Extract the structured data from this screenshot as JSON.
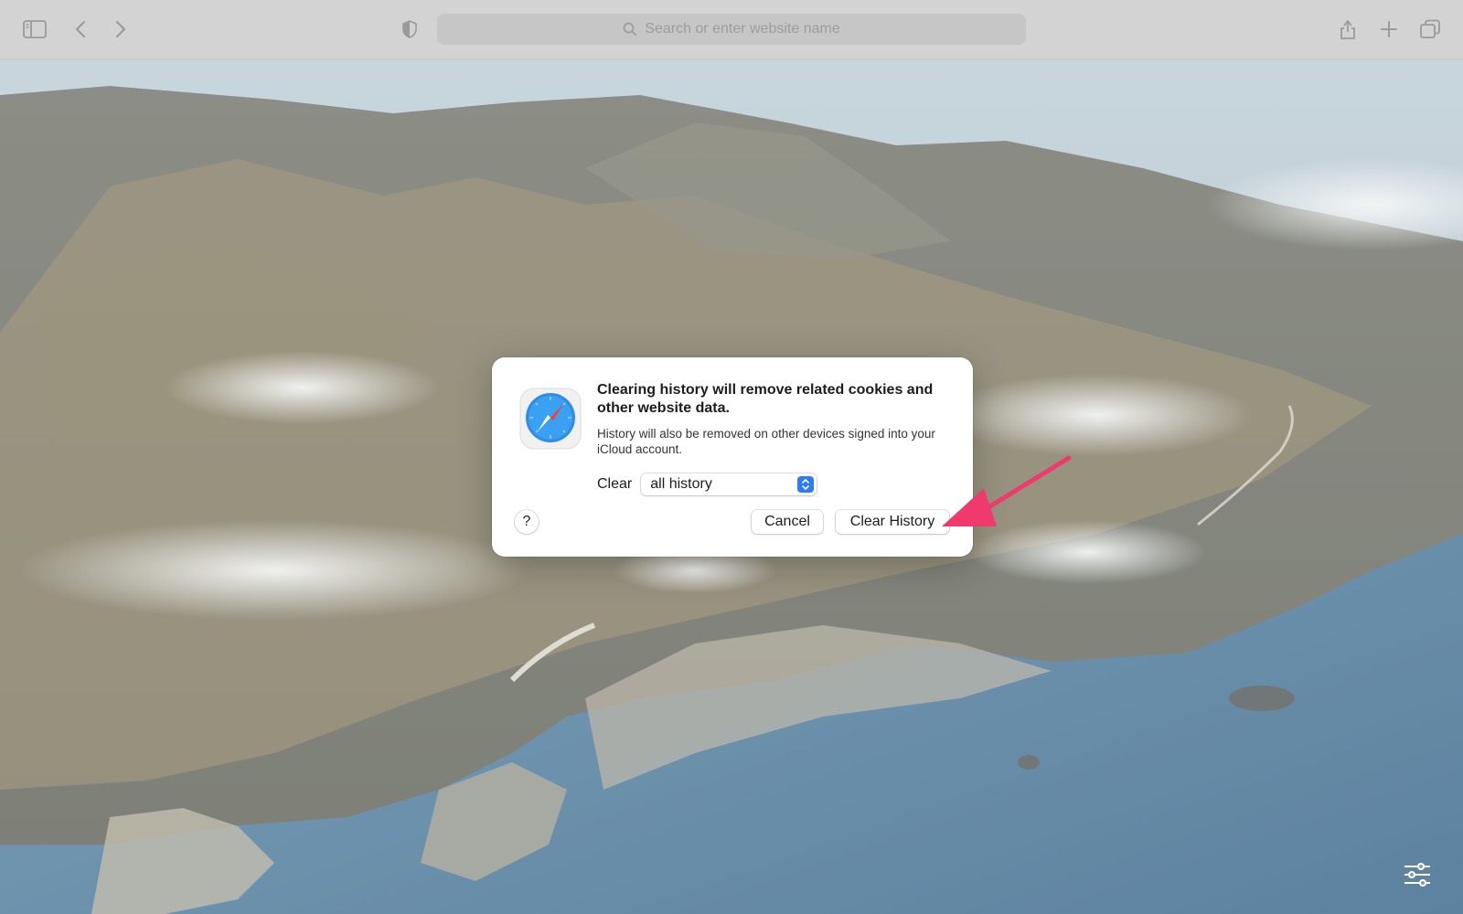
{
  "toolbar": {
    "search_placeholder": "Search or enter website name",
    "icons": [
      "sidebar-icon",
      "back-icon",
      "forward-icon",
      "privacy-shield-icon",
      "share-icon",
      "new-tab-icon",
      "tab-overview-icon"
    ]
  },
  "dialog": {
    "title": "Clearing history will remove related cookies and other website data.",
    "subtitle": "History will also be removed on other devices signed into your iCloud account.",
    "clear_label": "Clear",
    "clear_selected": "all history",
    "help_label": "?",
    "cancel_label": "Cancel",
    "confirm_label": "Clear History"
  },
  "colors": {
    "accent": "#2f7bf5",
    "annotation_arrow": "#f0396d",
    "toolbar_bg": "#d3d3d3"
  }
}
